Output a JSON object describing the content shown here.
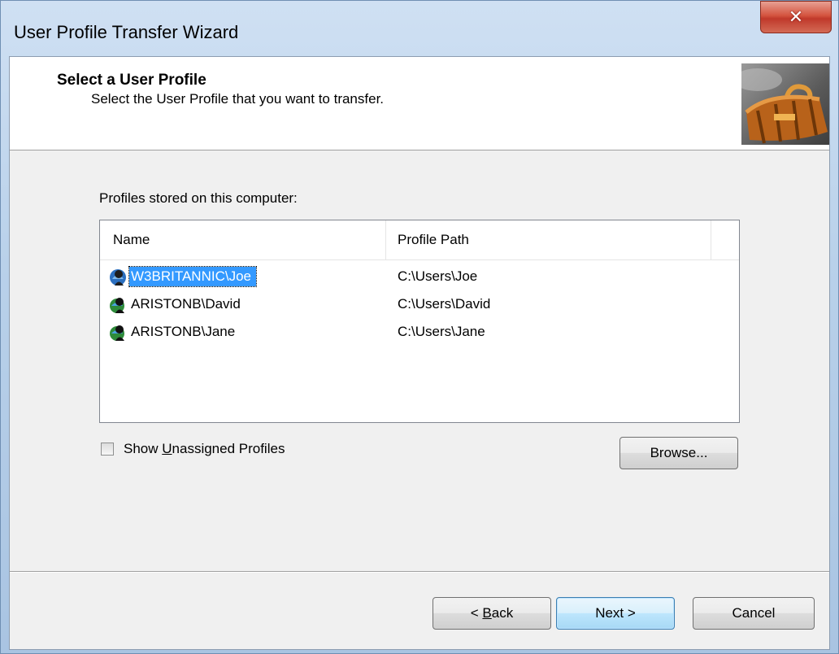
{
  "window": {
    "title": "User Profile Transfer Wizard",
    "close_label": "✕"
  },
  "header": {
    "title": "Select a User Profile",
    "subtitle": "Select the User Profile that you want to transfer."
  },
  "profiles_label": "Profiles stored on this computer:",
  "list": {
    "columns": [
      "Name",
      "Profile Path"
    ],
    "rows": [
      {
        "name": "W3BRITANNIC\\Joe",
        "path": "C:\\Users\\Joe",
        "selected": true
      },
      {
        "name": "ARISTONB\\David",
        "path": "C:\\Users\\David",
        "selected": false
      },
      {
        "name": "ARISTONB\\Jane",
        "path": "C:\\Users\\Jane",
        "selected": false
      }
    ]
  },
  "checkbox": {
    "label_pre": "Show ",
    "label_u": "U",
    "label_post": "nassigned Profiles",
    "checked": false
  },
  "buttons": {
    "browse": "Browse...",
    "back_pre": "< ",
    "back_u": "B",
    "back_post": "ack",
    "next": "Next >",
    "cancel": "Cancel"
  }
}
